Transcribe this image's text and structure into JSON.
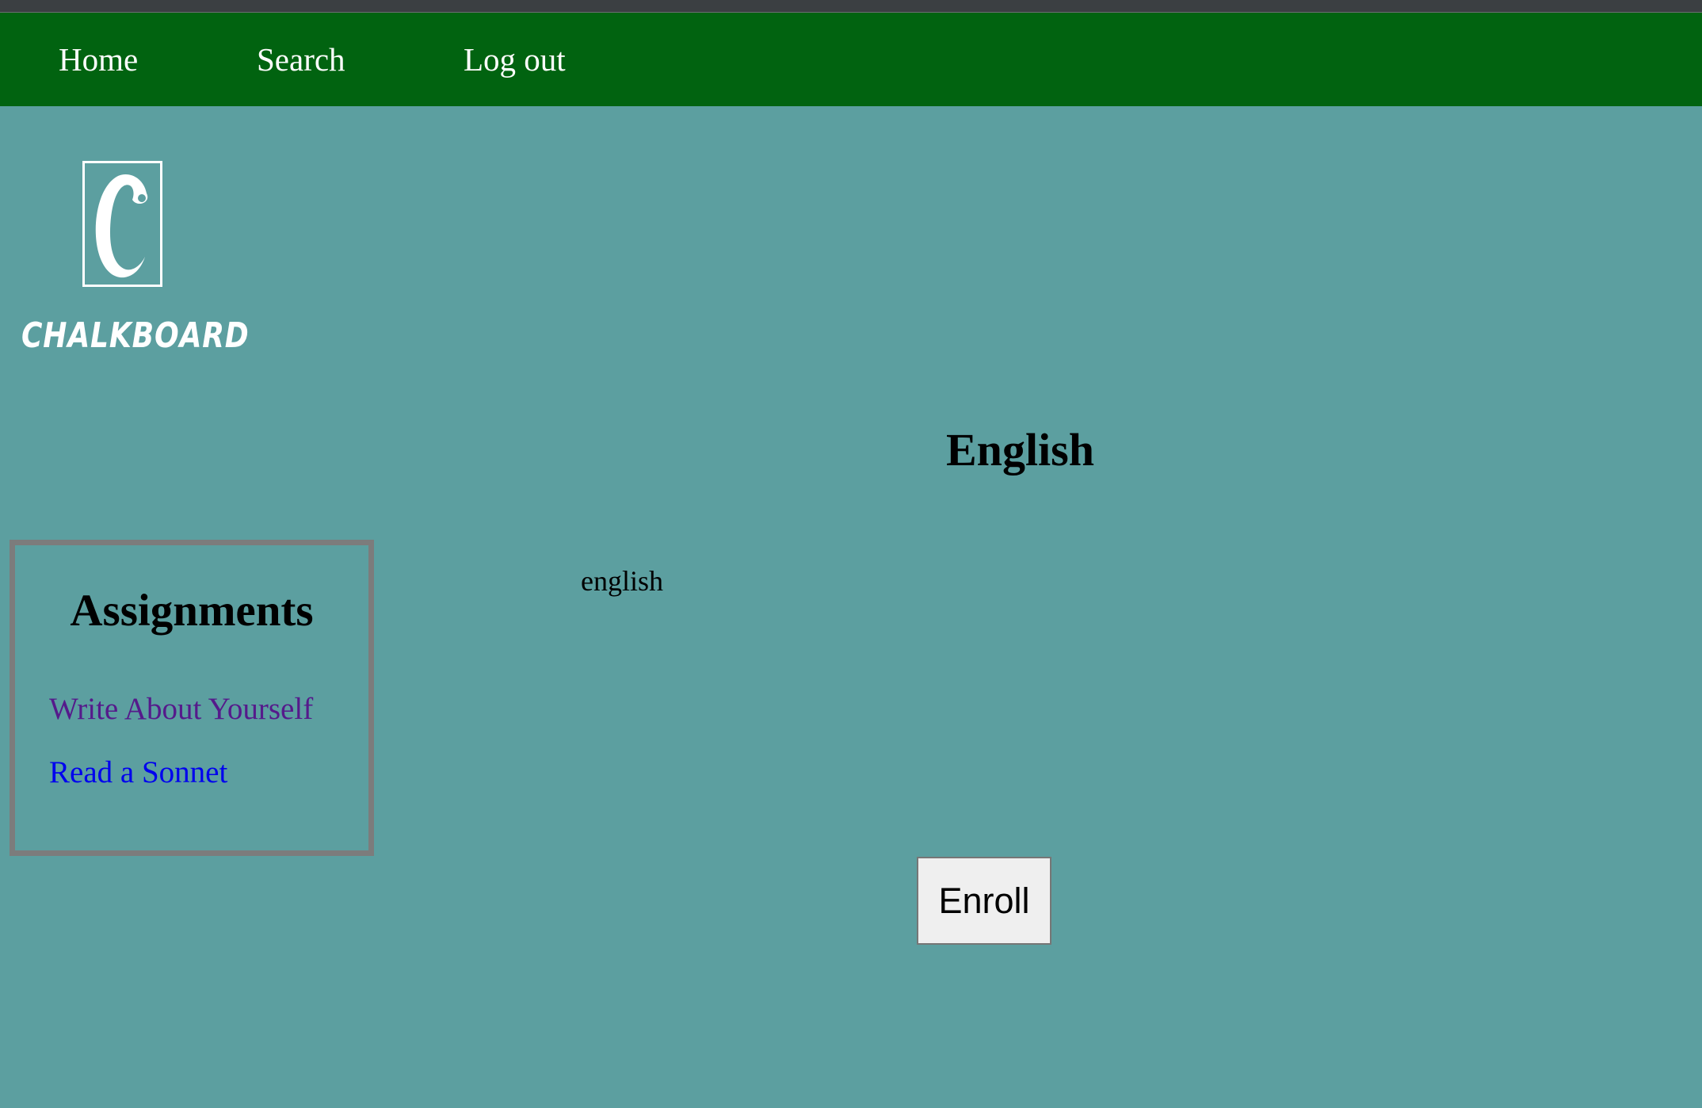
{
  "nav": {
    "home_label": "Home",
    "search_label": "Search",
    "logout_label": "Log out"
  },
  "logo": {
    "letter": "C",
    "text": "CHALKBOARD"
  },
  "assignments": {
    "title": "Assignments",
    "items": [
      {
        "label": "Write About Yourself",
        "state": "visited"
      },
      {
        "label": "Read a Sonnet",
        "state": "unvisited"
      }
    ]
  },
  "course": {
    "title": "English",
    "description": "english"
  },
  "enroll_button_label": "Enroll",
  "colors": {
    "background": "#5c9fa0",
    "navbar": "#016310",
    "visited_link": "#551a8b",
    "link": "#0000ee",
    "box_border": "#7c7c7c"
  }
}
